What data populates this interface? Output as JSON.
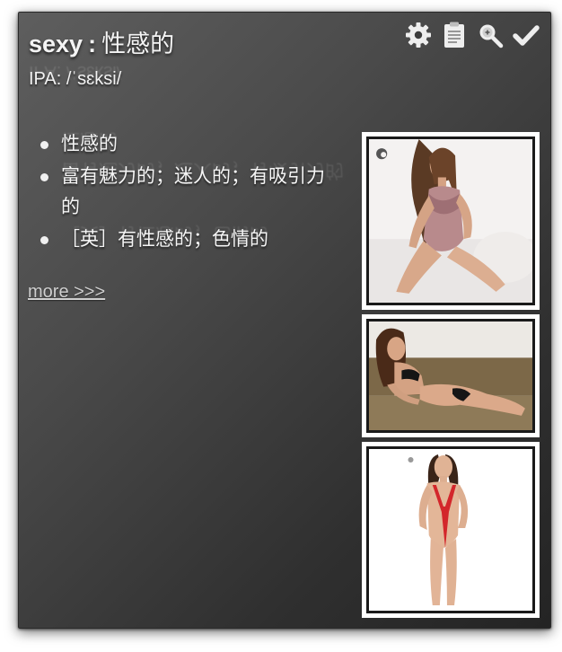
{
  "entry": {
    "word": "sexy",
    "separator": ":",
    "translation": "性感的",
    "ipa": "IPA: /ˈsɛksi/"
  },
  "toolbar": {
    "icons": [
      "gear-icon",
      "clipboard-icon",
      "zoom-icon",
      "checkmark-icon"
    ]
  },
  "definitions": [
    "性感的",
    "富有魅力的；迷人的；有吸引力的",
    "［英］有性感的；色情的"
  ],
  "more_link": "more >>>",
  "images": [
    {
      "name": "image-result-1"
    },
    {
      "name": "image-result-2"
    },
    {
      "name": "image-result-3"
    }
  ],
  "colors": {
    "panel_top": "#5e5e5e",
    "panel_bottom": "#242424",
    "text": "#f4f4f4",
    "link": "#cfcfcf"
  }
}
